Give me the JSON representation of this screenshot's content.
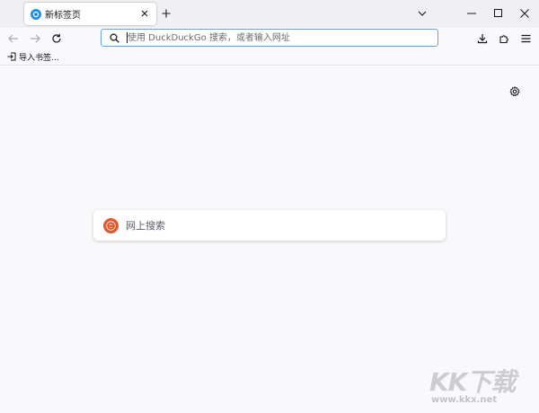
{
  "tab": {
    "title": "新标签页"
  },
  "urlbar": {
    "placeholder": "使用 DuckDuckGo 搜索，或者输入网址"
  },
  "bookmarks": {
    "import_label": "导入书签..."
  },
  "content": {
    "search_placeholder": "网上搜索"
  },
  "watermark": {
    "logo": "KK下载",
    "url": "www.kkx.net"
  },
  "colors": {
    "accent": "#5ea3e6",
    "ddg": "#de5833",
    "favicon": "#1f8fe8",
    "background": "#f9f9fb",
    "tabstrip": "#f0f0f4"
  },
  "icons": [
    "firefox-favicon-icon",
    "close-icon",
    "plus-icon",
    "chevron-down-icon",
    "minimize-icon",
    "maximize-icon",
    "window-close-icon",
    "back-arrow-icon",
    "forward-arrow-icon",
    "reload-icon",
    "search-icon",
    "download-icon",
    "extensions-icon",
    "menu-icon",
    "import-icon",
    "gear-icon",
    "duckduckgo-logo-icon"
  ]
}
